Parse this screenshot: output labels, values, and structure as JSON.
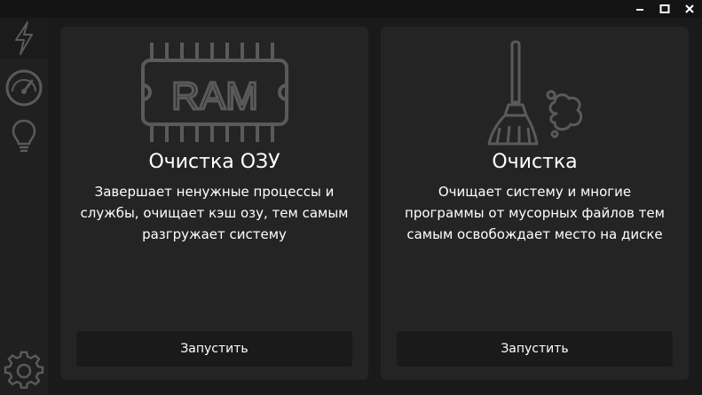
{
  "window_controls": {
    "minimize": "–",
    "maximize": "□",
    "close": "✕"
  },
  "sidebar": {
    "items": [
      {
        "icon": "lightning-icon",
        "active": true
      },
      {
        "icon": "speedometer-icon",
        "active": false
      },
      {
        "icon": "lightbulb-icon",
        "active": false
      },
      {
        "icon": "gear-icon",
        "active": false
      }
    ]
  },
  "cards": [
    {
      "icon": "ram-chip-icon",
      "title": "Очистка ОЗУ",
      "description": "Завершает ненужные процессы и службы, очищает кэш озу, тем самым разгружает систему",
      "button_label": "Запустить"
    },
    {
      "icon": "broom-icon",
      "title": "Очистка",
      "description": "Очищает систему и многие программы от мусорных файлов тем самым освобождает место на диске",
      "button_label": "Запустить"
    }
  ],
  "colors": {
    "background": "#1a1a1a",
    "sidebar": "#202020",
    "card": "#242424",
    "icon_gray": "#5a5a5a",
    "text": "#ffffff"
  }
}
